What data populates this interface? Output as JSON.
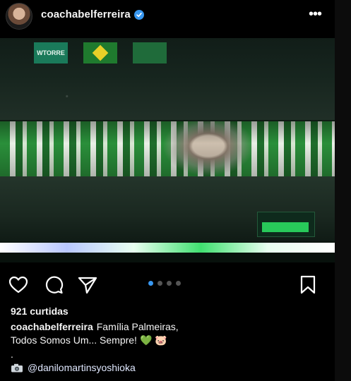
{
  "header": {
    "username": "coachabelferreira",
    "more_label": "•••"
  },
  "image": {
    "banner_text": "WTORRE"
  },
  "actions": {
    "carousel_dots": 4,
    "active_dot": 0
  },
  "likes_text": "921 curtidas",
  "caption": {
    "author": "coachabelferreira",
    "line1": "Família Palmeiras,",
    "line2": "Todos Somos Um... Sempre!",
    "line2_emoji": "💚 🐷",
    "line3": ".",
    "credit": "@danilomartinsyoshioka"
  },
  "colors": {
    "verified": "#3897f0",
    "active_dot": "#3897f0",
    "inactive_dot": "#555555"
  },
  "icons": [
    "heart-icon",
    "comment-icon",
    "share-icon",
    "bookmark-icon",
    "camera-icon",
    "verified-icon",
    "more-icon"
  ]
}
